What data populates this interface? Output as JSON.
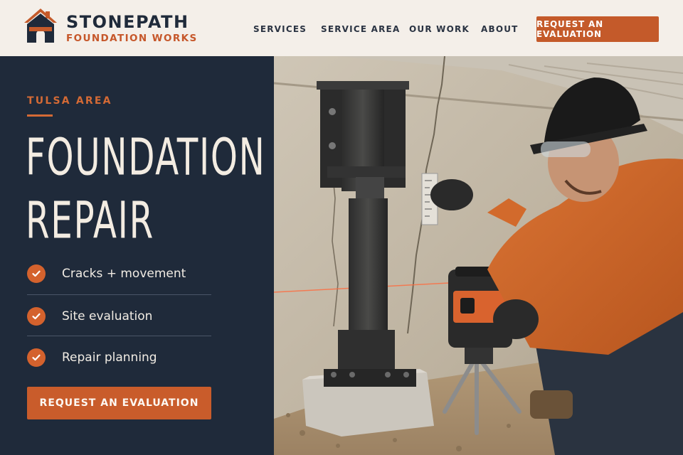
{
  "header": {
    "brand_name": "STONEPATH",
    "brand_sub": "FOUNDATION WORKS",
    "nav": [
      "SERVICES",
      "SERVICE AREA",
      "OUR WORK",
      "ABOUT"
    ],
    "cta_label": "REQUEST AN EVALUATION"
  },
  "hero": {
    "eyebrow": "TULSA AREA",
    "headline_line1": "FOUNDATION",
    "headline_line2": "REPAIR",
    "features": [
      "Cracks + movement",
      "Site evaluation",
      "Repair planning"
    ],
    "cta_label": "REQUEST AN EVALUATION"
  },
  "colors": {
    "navy": "#1f2a3a",
    "accent": "#c45a2a",
    "cream": "#f4efe9"
  },
  "icons": {
    "logo": "house-logo-icon",
    "check": "check-circle-icon"
  }
}
